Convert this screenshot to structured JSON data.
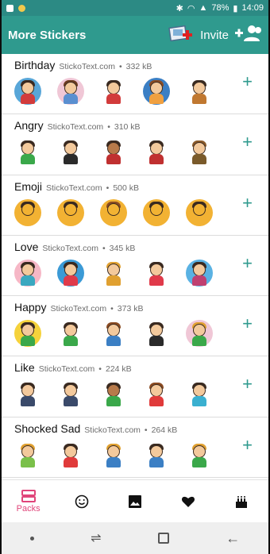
{
  "status_bar": {
    "battery": "78%",
    "time": "14:09"
  },
  "app_bar": {
    "title": "More Stickers",
    "invite_label": "Invite"
  },
  "packs": [
    {
      "name": "Birthday",
      "site": "StickoText.com",
      "size": "332 kB",
      "stickers": [
        "#58a6d8",
        "#f0c7d6",
        "#e6e6e6",
        "#3b7fc4",
        "#ffffff"
      ]
    },
    {
      "name": "Angry",
      "site": "StickoText.com",
      "size": "310 kB",
      "stickers": [
        "#ffffff",
        "#ffffff",
        "#ffffff",
        "#ffffff",
        "#ffffff"
      ]
    },
    {
      "name": "Emoji",
      "site": "StickoText.com",
      "size": "500 kB",
      "stickers": [
        "#ffffff",
        "#ffffff",
        "#ffffff",
        "#ffffff",
        "#ffffff"
      ]
    },
    {
      "name": "Love",
      "site": "StickoText.com",
      "size": "345 kB",
      "stickers": [
        "#f6b7c6",
        "#3b9ad6",
        "#ffffff",
        "#ffffff",
        "#5ab2e3"
      ]
    },
    {
      "name": "Happy",
      "site": "StickoText.com",
      "size": "373 kB",
      "stickers": [
        "#f5d23b",
        "#ffffff",
        "#ffffff",
        "#ffffff",
        "#f0c7d6"
      ]
    },
    {
      "name": "Like",
      "site": "StickoText.com",
      "size": "224 kB",
      "stickers": [
        "#ffffff",
        "#ffffff",
        "#ffffff",
        "#ffffff",
        "#ffffff"
      ]
    },
    {
      "name": "Shocked Sad",
      "site": "StickoText.com",
      "size": "264 kB",
      "stickers": [
        "#ffffff",
        "#ffffff",
        "#ffffff",
        "#ffffff",
        "#ffffff"
      ]
    }
  ],
  "bottom_nav": {
    "active_label": "Packs"
  },
  "colors": {
    "primary": "#2f9a8e",
    "accent": "#e0457a"
  }
}
